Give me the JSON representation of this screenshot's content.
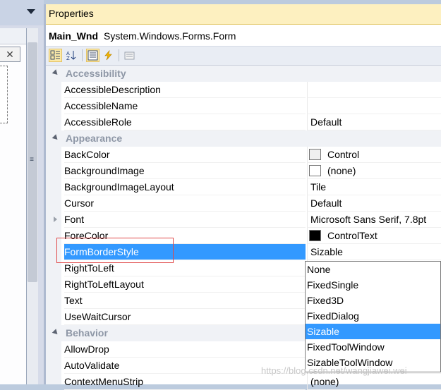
{
  "window": {
    "title": "Properties",
    "object_name": "Main_Wnd",
    "object_type": "System.Windows.Forms.Form"
  },
  "left_panel": {
    "close_glyph": "✕",
    "grip_glyph": "≡"
  },
  "toolbar": {
    "buttons": [
      "categorized-icon",
      "alphabetical-icon",
      "properties-icon",
      "events-icon",
      "property-pages-icon"
    ]
  },
  "grid": {
    "categories": {
      "accessibility": "Accessibility",
      "appearance": "Appearance",
      "behavior": "Behavior"
    },
    "rows": {
      "accessible_description": {
        "name": "AccessibleDescription",
        "value": ""
      },
      "accessible_name": {
        "name": "AccessibleName",
        "value": ""
      },
      "accessible_role": {
        "name": "AccessibleRole",
        "value": "Default"
      },
      "back_color": {
        "name": "BackColor",
        "value": "Control",
        "swatch": "#f0f0f0"
      },
      "background_image": {
        "name": "BackgroundImage",
        "value": "(none)",
        "swatch": "#ffffff"
      },
      "background_image_layout": {
        "name": "BackgroundImageLayout",
        "value": "Tile"
      },
      "cursor": {
        "name": "Cursor",
        "value": "Default"
      },
      "font": {
        "name": "Font",
        "value": "Microsoft Sans Serif, 7.8pt"
      },
      "fore_color": {
        "name": "ForeColor",
        "value": "ControlText",
        "swatch": "#000000"
      },
      "form_border_style": {
        "name": "FormBorderStyle",
        "value": "Sizable"
      },
      "right_to_left": {
        "name": "RightToLeft",
        "value": ""
      },
      "right_to_left_layout": {
        "name": "RightToLeftLayout",
        "value": ""
      },
      "text": {
        "name": "Text",
        "value": ""
      },
      "use_wait_cursor": {
        "name": "UseWaitCursor",
        "value": ""
      },
      "allow_drop": {
        "name": "AllowDrop",
        "value": ""
      },
      "auto_validate": {
        "name": "AutoValidate",
        "value": ""
      },
      "context_menu_strip": {
        "name": "ContextMenuStrip",
        "value": "(none)"
      }
    }
  },
  "dropdown": {
    "options": [
      "None",
      "FixedSingle",
      "Fixed3D",
      "FixedDialog",
      "Sizable",
      "FixedToolWindow",
      "SizableToolWindow"
    ],
    "selected": "Sizable"
  },
  "watermark": "https://blog.csdn.net/wangjiawei.wei",
  "colors": {
    "title_bar": "#fdf0c0",
    "selection": "#3399ff",
    "highlight_box": "#e04848"
  }
}
